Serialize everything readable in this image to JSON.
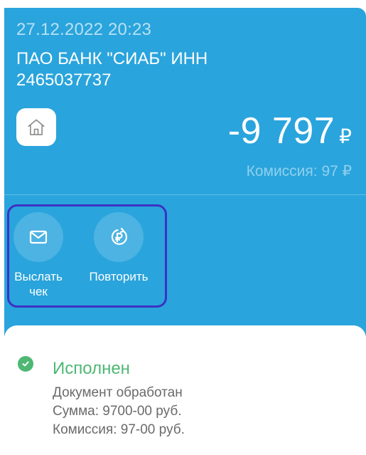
{
  "transaction": {
    "datetime": "27.12.2022 20:23",
    "merchant": "ПАО БАНК \"СИАБ\" ИНН 2465037737",
    "category_icon": "house-icon",
    "amount": "-9 797",
    "currency": "₽",
    "commission": "Комиссия: 97 ₽"
  },
  "actions": [
    {
      "label": "Выслать чек",
      "icon": "envelope-icon"
    },
    {
      "label": "Повторить",
      "icon": "repeat-ruble-icon"
    }
  ],
  "status": {
    "title": "Исполнен",
    "icon": "check-circle-icon",
    "lines": [
      "Документ обработан",
      "Сумма: 9700-00 руб.",
      "Комиссия: 97-00 руб."
    ]
  },
  "colors": {
    "header_bg": "#2aa4dc",
    "highlight_border": "#3c32c4",
    "status_green": "#4fb774"
  }
}
